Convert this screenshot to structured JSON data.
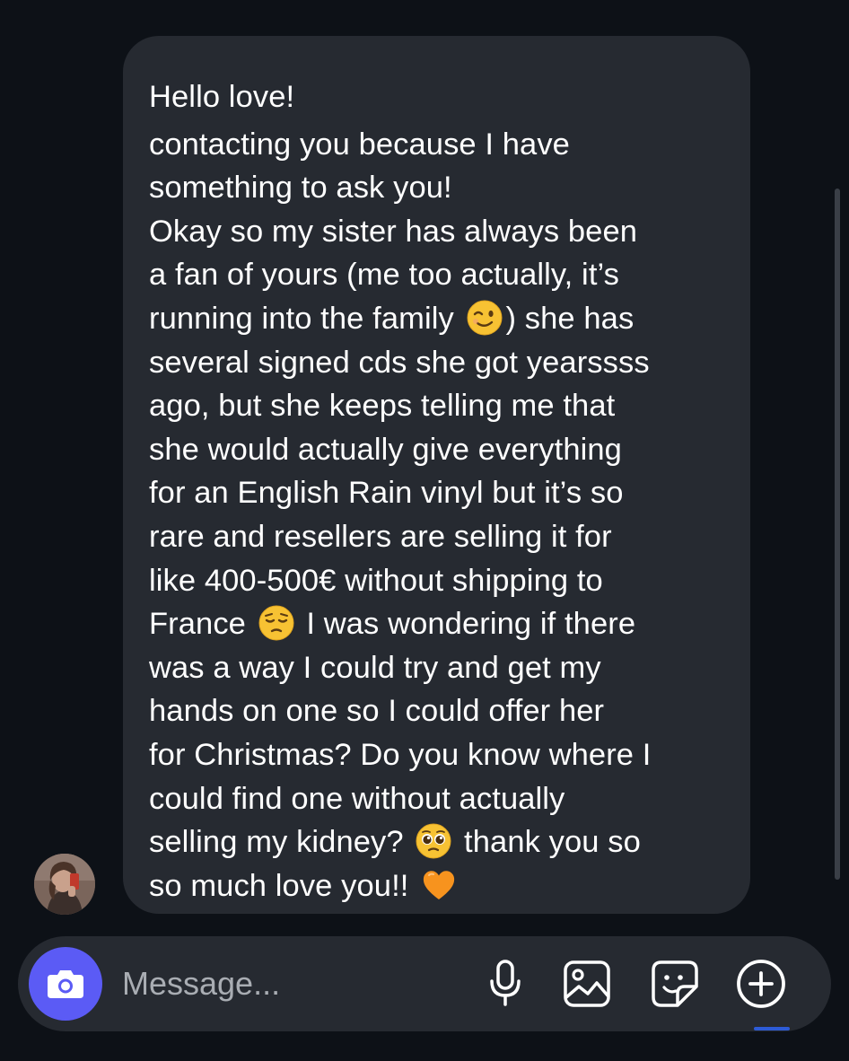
{
  "message": {
    "lines": [
      {
        "text": "Hello love!"
      },
      {
        "text": "contacting you because I have"
      },
      {
        "text": "something to ask you!"
      },
      {
        "text": "Okay so my sister has always been"
      },
      {
        "text": "a fan of yours (me too actually, it’s"
      },
      {
        "before": "running into the family ",
        "emoji": "winking-face-emoji",
        "after": ") she has"
      },
      {
        "text": "several signed cds she got yearssss"
      },
      {
        "text": "ago, but she keeps telling me that"
      },
      {
        "text": "she would actually give everything"
      },
      {
        "text": "for an English Rain vinyl but it’s so"
      },
      {
        "text": "rare and resellers are selling it for"
      },
      {
        "text": "like 400-500€ without shipping to"
      },
      {
        "before": "France ",
        "emoji": "pensive-face-emoji",
        "after": " I was wondering if there"
      },
      {
        "text": "was a way I could try and get my"
      },
      {
        "text": "hands on one so I could offer her"
      },
      {
        "text": "for Christmas? Do you know where I"
      },
      {
        "text": "could find one without actually"
      },
      {
        "before": "selling my kidney? ",
        "emoji": "pleading-face-emoji",
        "after": " thank you so"
      },
      {
        "before": "so much love you!! ",
        "emoji": "orange-heart-emoji",
        "after": ""
      }
    ]
  },
  "sender": {
    "avatar_icon": "profile-photo"
  },
  "composer": {
    "placeholder": "Message...",
    "camera_icon": "camera-icon",
    "icons": [
      "microphone-icon",
      "image-gallery-icon",
      "sticker-icon",
      "plus-circle-icon"
    ]
  },
  "colors": {
    "background": "#0d1117",
    "bubble": "#262a31",
    "camera_button": "#5b5bf5",
    "text": "#ffffff",
    "placeholder": "#a9adb3"
  }
}
